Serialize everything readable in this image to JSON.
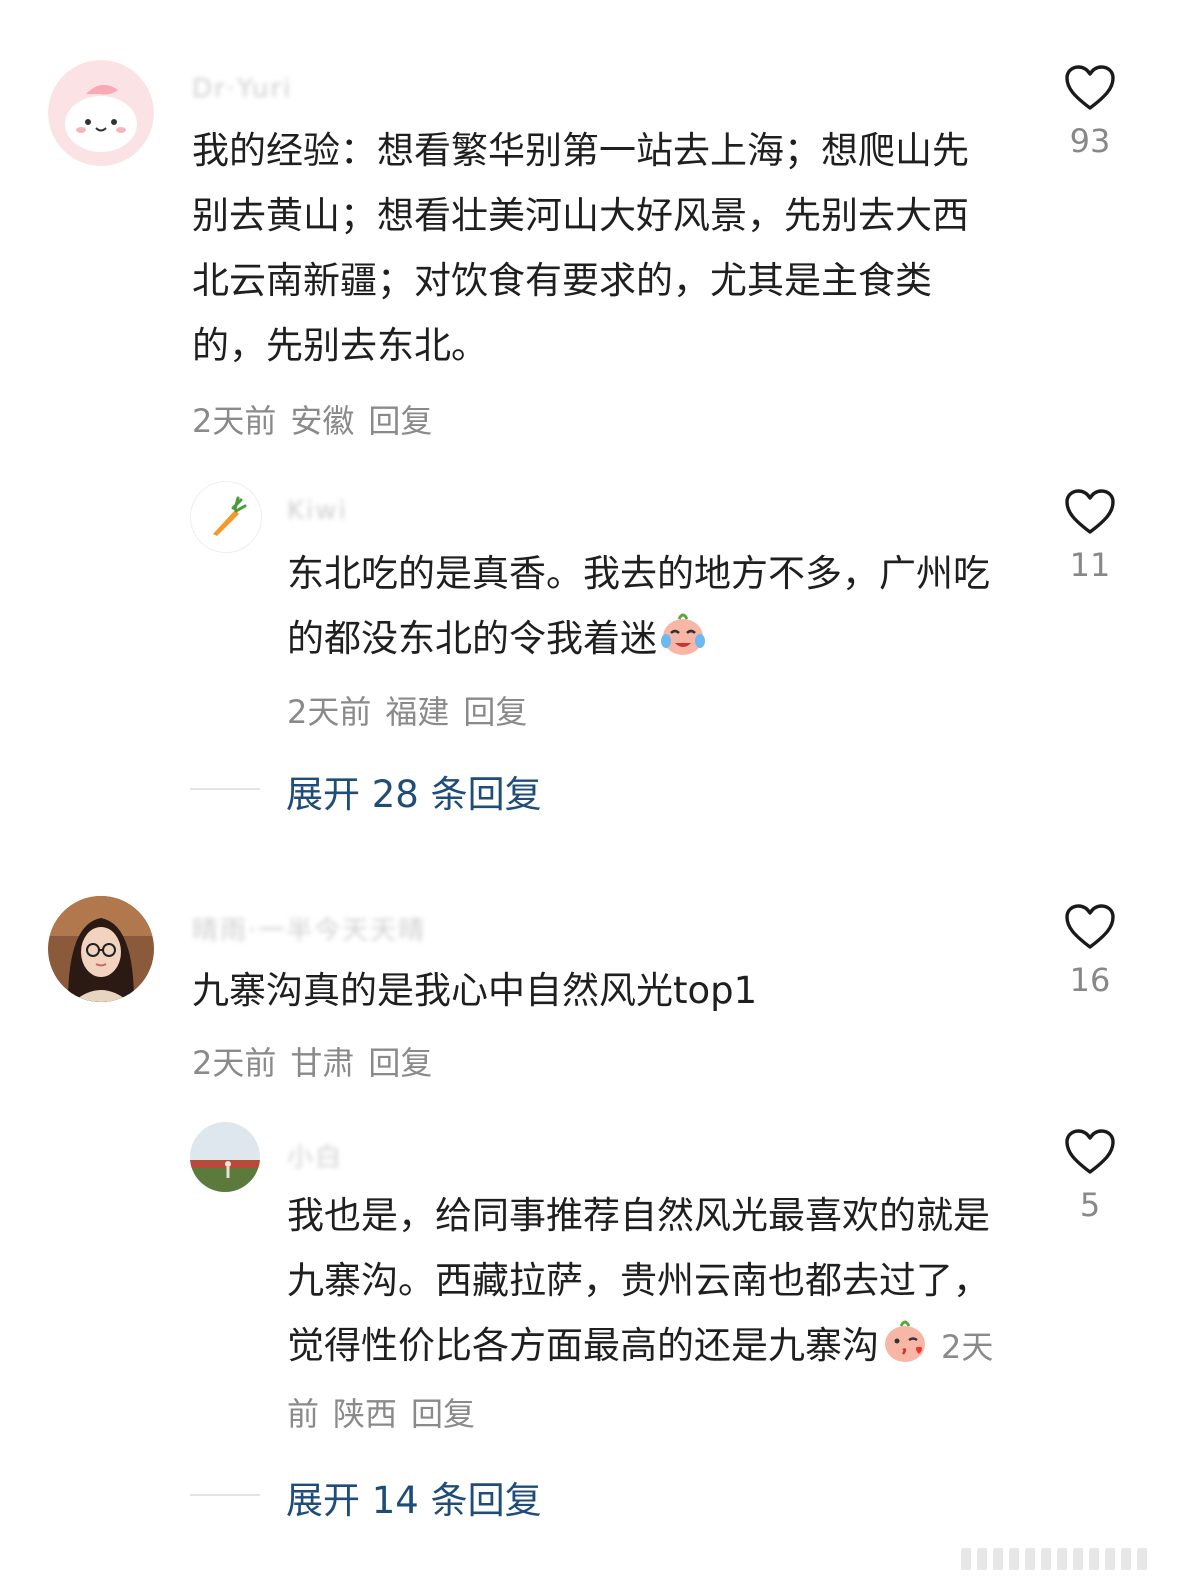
{
  "comments": [
    {
      "username": "Dr·Yuri",
      "text": "我的经验：想看繁华别第一站去上海；想爬山先别去黄山；想看壮美河山大好风景，先别去大西北云南新疆；对饮食有要求的，尤其是主食类的，先别去东北。",
      "time": "2天前",
      "location": "安徽",
      "reply_label": "回复",
      "likes": "93",
      "replies": [
        {
          "username": "Kiwi",
          "text": "东北吃的是真香。我去的地方不多，广州吃的都没东北的令我着迷",
          "time": "2天前",
          "location": "福建",
          "reply_label": "回复",
          "likes": "11"
        }
      ],
      "expand_label": "展开 28 条回复"
    },
    {
      "username": "晴雨·一半今天天晴",
      "text": "九寨沟真的是我心中自然风光top1",
      "time": "2天前",
      "location": "甘肃",
      "reply_label": "回复",
      "likes": "16",
      "replies": [
        {
          "username": "小白",
          "text": "我也是，给同事推荐自然风光最喜欢的就是九寨沟。西藏拉萨，贵州云南也都去过了，觉得性价比各方面最高的还是九寨沟",
          "time": "2天前",
          "location": "陕西",
          "reply_label": "回复",
          "likes": "5"
        }
      ],
      "expand_label": "展开 14 条回复"
    }
  ],
  "icons": {
    "like": "heart-outline-icon",
    "reply_expand_line": "divider"
  },
  "colors": {
    "text": "#1f1f1f",
    "meta": "#8a8a8a",
    "expand": "#1f4d7a",
    "heart": "#1a1a1a"
  }
}
